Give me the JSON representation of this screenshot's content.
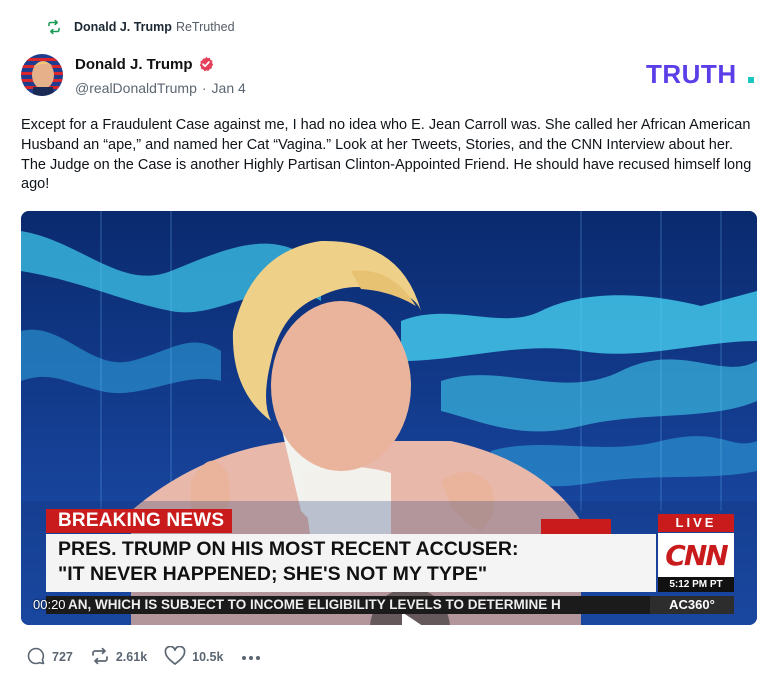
{
  "retruth": {
    "icon": "retruth-icon",
    "name": "Donald J. Trump",
    "label": "ReTruthed"
  },
  "author": {
    "name": "Donald J. Trump",
    "verified_icon": "verified-badge-icon",
    "handle": "@realDonaldTrump",
    "separator": "·",
    "date": "Jan 4"
  },
  "brand": {
    "logo": "truth-logo",
    "text": "TRUTH.",
    "color": "#5b3ee8",
    "dot_color": "#19c7c0"
  },
  "post": {
    "text": "Except for a Fraudulent Case against me, I had no idea who E. Jean Carroll was. She called her African American Husband an “ape,” and named her Cat “Vagina.” Look at her Tweets, Stories, and the CNN Interview about her. The Judge on the Case is another Highly Partisan Clinton-Appointed Friend. He should have recused himself long ago!"
  },
  "video": {
    "breaking": "BREAKING NEWS",
    "headline_1": "PRES. TRUMP ON HIS MOST RECENT ACCUSER:",
    "headline_2": "\"IT NEVER HAPPENED; SHE'S NOT MY TYPE\"",
    "live": "LIVE",
    "network": "CNN",
    "clock": "5:12 PM PT",
    "ticker": "AN, WHICH IS SUBJECT TO INCOME ELIGIBILITY LEVELS TO DETERMINE H",
    "show": "AC360°",
    "timecode": "00:20",
    "play_icon": "play-icon"
  },
  "actions": {
    "replies": "727",
    "retruths": "2.61k",
    "likes": "10.5k",
    "reply_icon": "reply-icon",
    "retruth_icon": "retruth-icon",
    "like_icon": "heart-icon",
    "more_icon": "more-icon"
  },
  "colors": {
    "retruth_green": "#1c9b55",
    "verified_red": "#e4405a",
    "cnn_red": "#c91b1b"
  }
}
